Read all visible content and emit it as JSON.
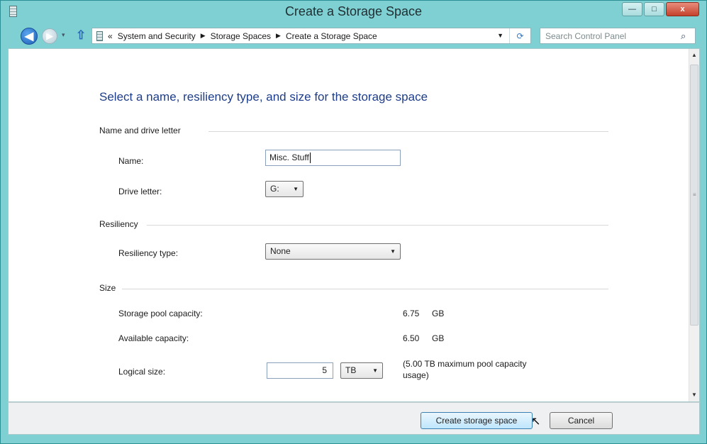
{
  "window": {
    "title": "Create a Storage Space",
    "controls": {
      "minimize": "—",
      "maximize": "□",
      "close": "x"
    }
  },
  "nav": {
    "back": "◀",
    "forward": "▶",
    "history_dropdown": "▾",
    "up": "⇧"
  },
  "address_bar": {
    "overflow": "«",
    "crumbs": [
      "System and Security",
      "Storage Spaces",
      "Create a Storage Space"
    ],
    "separator": "▶",
    "dropdown": "▼",
    "refresh": "⟳"
  },
  "search": {
    "placeholder": "Search Control Panel",
    "icon": "⌕"
  },
  "main": {
    "heading": "Select a name, resiliency type, and size for the storage space",
    "name_group": {
      "title": "Name and drive letter",
      "name_label": "Name:",
      "name_value": "Misc. Stuff",
      "drive_label": "Drive letter:",
      "drive_value": "G:"
    },
    "resiliency_group": {
      "title": "Resiliency",
      "type_label": "Resiliency type:",
      "type_value": "None"
    },
    "size_group": {
      "title": "Size",
      "pool_capacity_label": "Storage pool capacity:",
      "pool_capacity_value": "6.75",
      "pool_capacity_unit": "GB",
      "available_label": "Available capacity:",
      "available_value": "6.50",
      "available_unit": "GB",
      "logical_label": "Logical size:",
      "logical_value": "5",
      "logical_unit": "TB",
      "logical_note_line1": "(5.00 TB maximum pool capacity",
      "logical_note_line2": "usage)"
    },
    "dropdown_arrow": "▼"
  },
  "scrollbar": {
    "up": "▲",
    "down": "▼",
    "grip": "≡"
  },
  "footer": {
    "create_label": "Create storage space",
    "cancel_label": "Cancel"
  },
  "cursor": "↖"
}
